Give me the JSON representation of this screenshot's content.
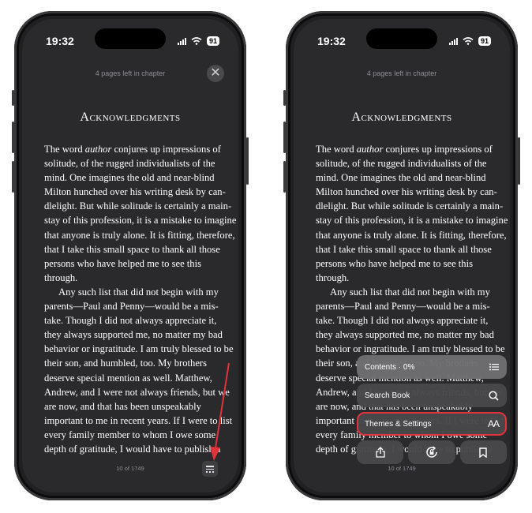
{
  "left": {
    "status": {
      "time": "19:32",
      "battery": "91"
    },
    "pages_left": "4 pages left in chapter",
    "chapter_title": "Acknowledgments",
    "lines": [
      {
        "t": "The word ",
        "em": "author",
        "r": " conjures up impressions of"
      },
      {
        "t": "solitude, of the rugged individualists of the"
      },
      {
        "t": "mind. One imagines the old and near-blind"
      },
      {
        "t": "Milton hunched over his writing desk by can-"
      },
      {
        "t": "dlelight. But while solitude is certainly a main-"
      },
      {
        "t": "stay of this profession, it is a mistake to imagine"
      },
      {
        "t": "that anyone is truly alone. It is fitting, therefore,"
      },
      {
        "t": "that I take this small space to thank all those"
      },
      {
        "t": "persons who have helped me to see this"
      },
      {
        "t": "through."
      },
      {
        "t": "Any such list that did not begin with my",
        "indent": true
      },
      {
        "t": "parents—Paul and Penny—would be a mis-"
      },
      {
        "t": "take. Though I did not always appreciate it,"
      },
      {
        "t": "they always supported me, no matter my bad"
      },
      {
        "t": "behavior or ingratitude. I am truly blessed to be"
      },
      {
        "t": "their son, and humbled, too. My brothers"
      },
      {
        "t": "deserve special mention as well. Matthew,"
      },
      {
        "t": "Andrew, and I were not always friends, but we"
      },
      {
        "t": "are now, and that has been unspeakably"
      },
      {
        "t": "important to me in recent years. If I were to list"
      },
      {
        "t": "every family member to whom I owe some"
      },
      {
        "t": "depth of gratitude, I would have to publish a"
      }
    ],
    "page_number": "10 of 1749"
  },
  "right": {
    "status": {
      "time": "19:32",
      "battery": "91"
    },
    "pages_left": "4 pages left in chapter",
    "chapter_title": "Acknowledgments",
    "page_number": "10 of 1749",
    "menu": {
      "contents_label": "Contents · 0%",
      "search_label": "Search Book",
      "themes_label": "Themes & Settings",
      "themes_icon_text": "AA"
    }
  },
  "colors": {
    "accent_red": "#e3323b",
    "screen_bg": "#2a2a2c"
  }
}
